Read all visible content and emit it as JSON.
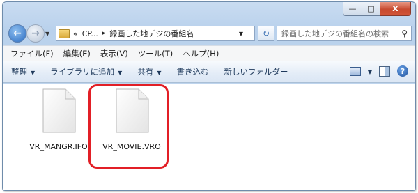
{
  "window": {
    "caption_buttons": {
      "minimize": "—",
      "maximize": "□",
      "close": "x"
    }
  },
  "navigation": {
    "back_icon": "back-arrow-icon",
    "forward_icon": "forward-arrow-icon",
    "address": {
      "overflow": "«",
      "segments": [
        "CP...",
        "録画した地デジの番組名"
      ],
      "separator": "▸"
    },
    "refresh_icon": "refresh-icon",
    "search": {
      "placeholder": "録画した地デジの番組名の検索"
    }
  },
  "menu": {
    "items": [
      "ファイル(F)",
      "編集(E)",
      "表示(V)",
      "ツール(T)",
      "ヘルプ(H)"
    ]
  },
  "commandbar": {
    "organize": "整理",
    "add_to_library": "ライブラリに追加",
    "share": "共有",
    "burn": "書き込む",
    "new_folder": "新しいフォルダー",
    "view_icon": "view-options-icon",
    "preview_pane_icon": "preview-pane-icon",
    "help_icon": "help-icon",
    "help_symbol": "?"
  },
  "files": [
    {
      "name": "VR_MANGR.IFO",
      "icon": "file-icon"
    },
    {
      "name": "VR_MOVIE.VRO",
      "icon": "file-icon",
      "highlighted": true
    }
  ],
  "colors": {
    "highlight": "#e21f26",
    "accent": "#1e395b"
  }
}
